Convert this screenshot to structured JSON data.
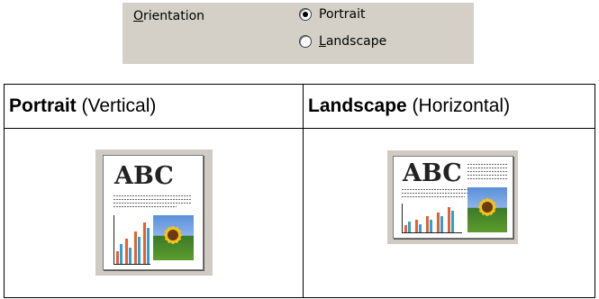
{
  "dialog": {
    "label_prefix_underlined": "O",
    "label_rest": "rientation",
    "options": [
      {
        "ul_pre": "",
        "ul": "",
        "rest": "Portrait",
        "selected": true
      },
      {
        "ul_pre": "",
        "ul": "L",
        "rest": "andscape",
        "selected": false
      }
    ]
  },
  "table": {
    "col1_strong": "Portrait",
    "col1_rest": " (Vertical)",
    "col2_strong": "Landscape",
    "col2_rest": " (Horizontal)"
  },
  "thumbnails": {
    "abc_text": "ABC",
    "chart_colors": [
      "#e8602c",
      "#2ca0d8"
    ],
    "photo": "sunflower"
  }
}
